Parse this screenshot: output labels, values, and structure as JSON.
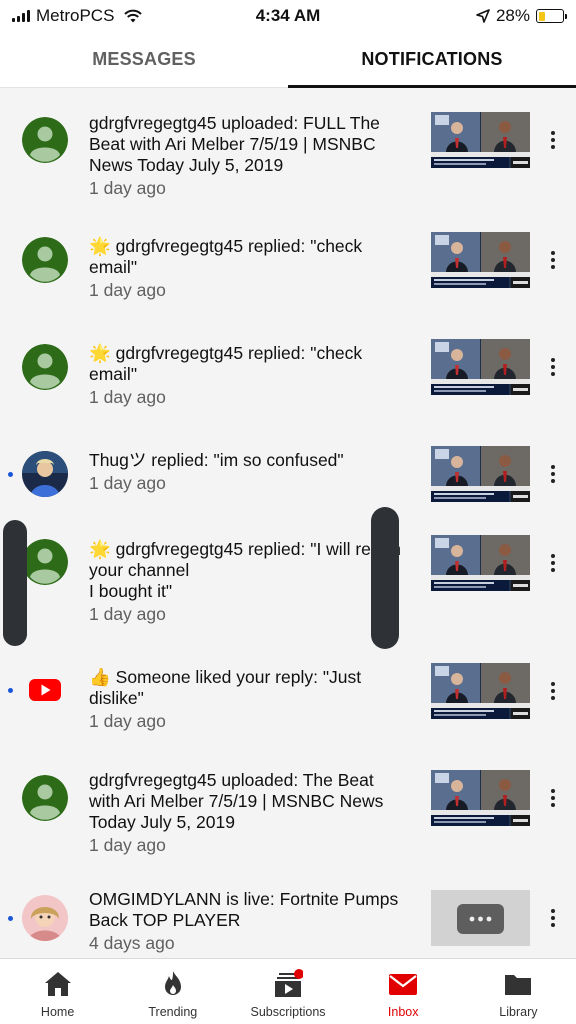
{
  "status_bar": {
    "carrier": "MetroPCS",
    "time": "4:34 AM",
    "battery_percent": "28%",
    "battery_level": 0.28
  },
  "tabs": [
    {
      "label": "MESSAGES",
      "active": false
    },
    {
      "label": "NOTIFICATIONS",
      "active": true
    }
  ],
  "notifications": [
    {
      "text": "gdrgfvregegtg45 uploaded: FULL The Beat with Ari Melber 7/5/19 | MSNBC News Today July 5, 2019",
      "time": "1 day ago",
      "unread": false,
      "avatar": "default-user-icon",
      "thumbnail": "msnbc-split-screen"
    },
    {
      "text": "🌟 gdrgfvregegtg45 replied: \"check email\"",
      "time": "1 day ago",
      "unread": false,
      "avatar": "default-user-icon",
      "thumbnail": "msnbc-split-screen"
    },
    {
      "text": "🌟 gdrgfvregegtg45 replied: \"check email\"",
      "time": "1 day ago",
      "unread": false,
      "avatar": "default-user-icon",
      "thumbnail": "msnbc-split-screen"
    },
    {
      "text": "Thugツ replied: \"im so confused\"",
      "time": "1 day ago",
      "unread": true,
      "avatar": "photo-avatar-blue",
      "thumbnail": "msnbc-split-screen"
    },
    {
      "text": "🌟 gdrgfvregegtg45 replied: \"I will return your channel\nI bought it\"",
      "time": "1 day ago",
      "unread": false,
      "avatar": "default-user-icon",
      "thumbnail": "msnbc-split-screen"
    },
    {
      "text": "👍 Someone liked your reply: \"Just dislike\"",
      "time": "1 day ago",
      "unread": true,
      "avatar": "youtube-logo-icon",
      "thumbnail": "msnbc-split-screen"
    },
    {
      "text": "gdrgfvregegtg45 uploaded: The Beat with Ari Melber 7/5/19 | MSNBC News Today July 5, 2019",
      "time": "1 day ago",
      "unread": false,
      "avatar": "default-user-icon",
      "thumbnail": "msnbc-split-screen"
    },
    {
      "text": "OMGIMDYLANN is live: Fortnite Pumps Back TOP PLAYER",
      "time": "4 days ago",
      "unread": true,
      "avatar": "photo-avatar-pink",
      "thumbnail": "live-placeholder"
    }
  ],
  "bottom_nav": [
    {
      "label": "Home",
      "icon": "home-icon",
      "active": false
    },
    {
      "label": "Trending",
      "icon": "flame-icon",
      "active": false
    },
    {
      "label": "Subscriptions",
      "icon": "subscriptions-icon",
      "active": false,
      "badge": true
    },
    {
      "label": "Inbox",
      "icon": "inbox-icon",
      "active": true
    },
    {
      "label": "Library",
      "icon": "folder-icon",
      "active": false
    }
  ],
  "colors": {
    "accent_red": "#e00000",
    "unread_dot": "#1a56d6",
    "default_avatar_bg": "#2d6b18",
    "youtube_red": "#ff0000"
  }
}
